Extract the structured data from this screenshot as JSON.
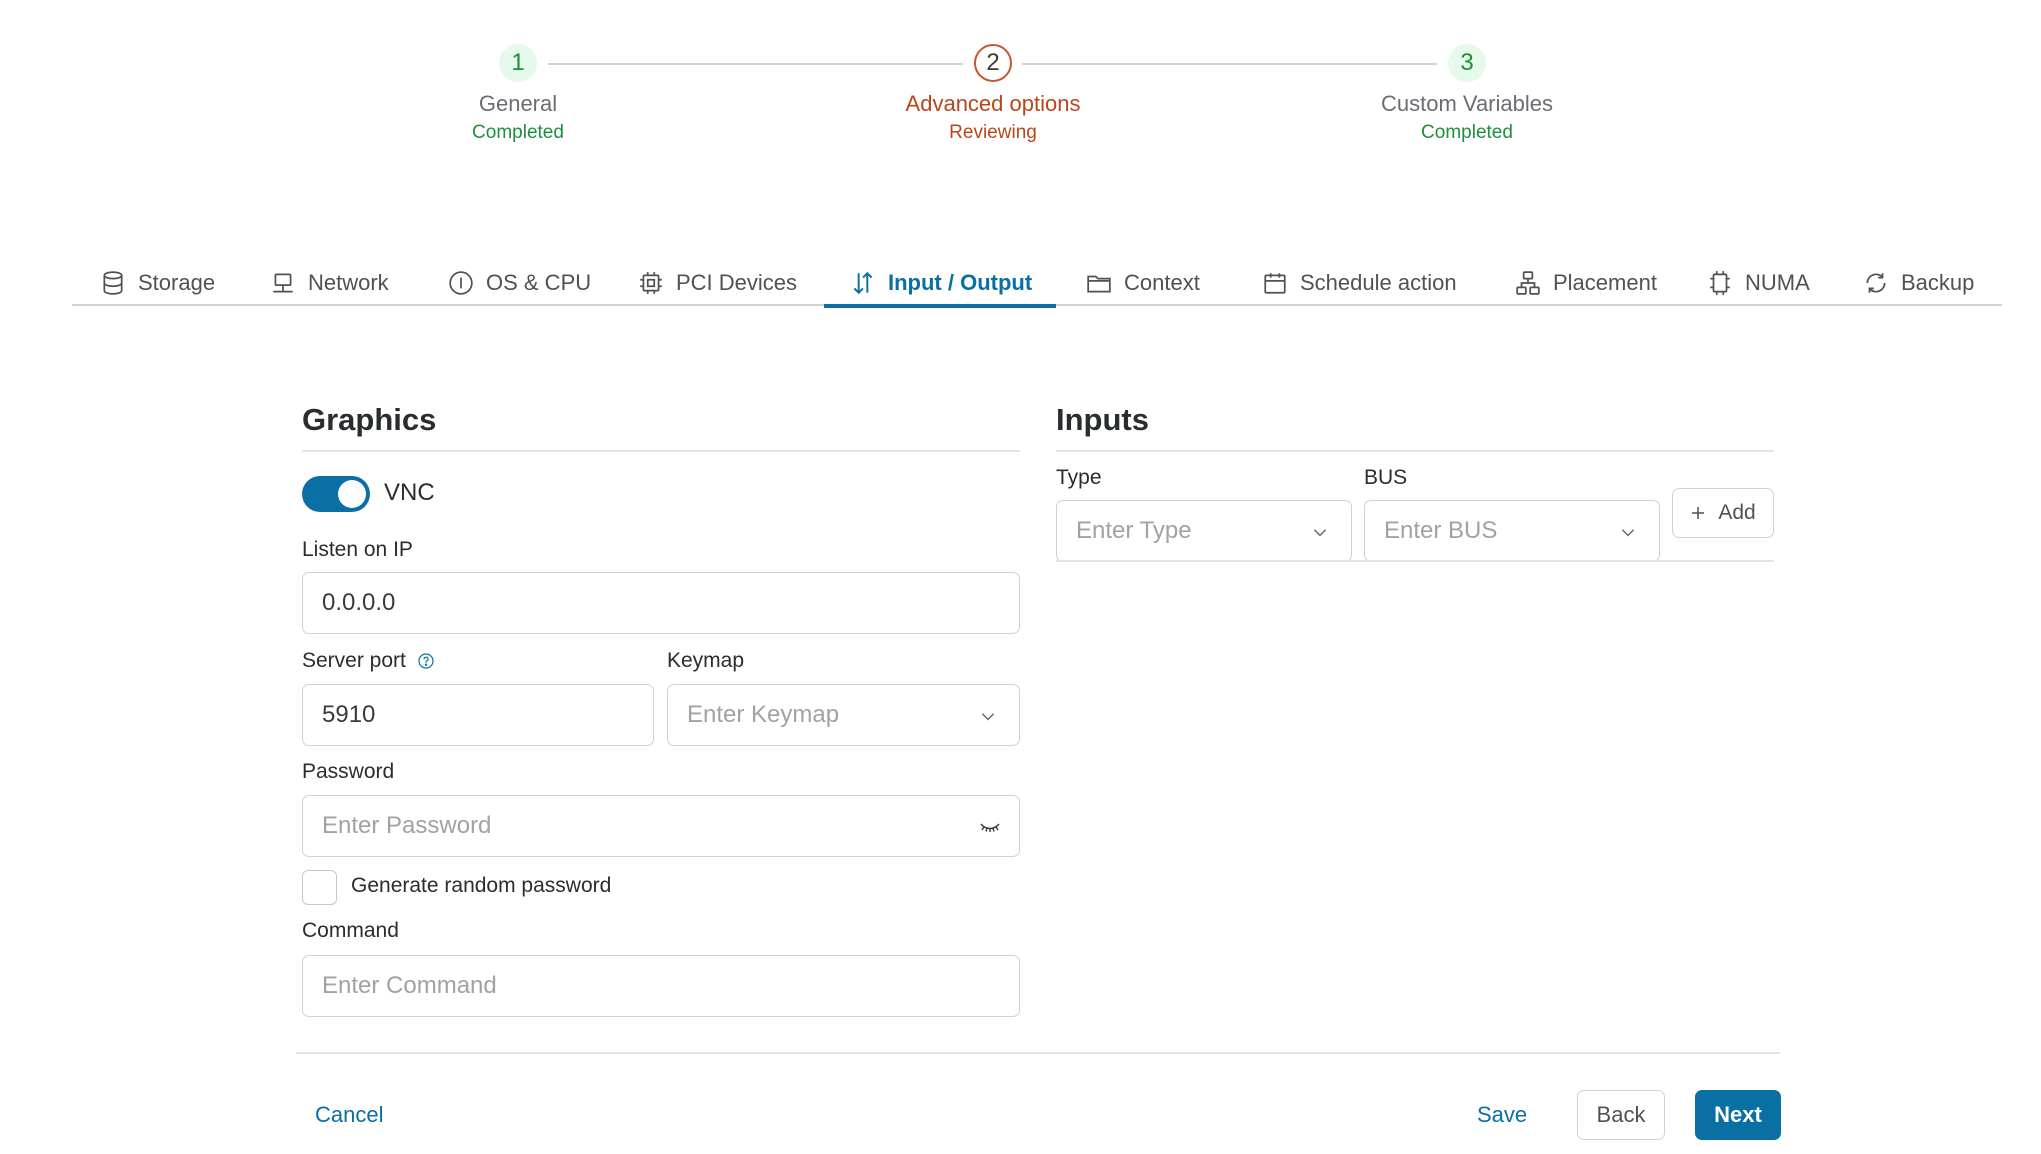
{
  "stepper": {
    "steps": [
      {
        "number": "1",
        "title": "General",
        "status": "Completed"
      },
      {
        "number": "2",
        "title": "Advanced options",
        "status": "Reviewing"
      },
      {
        "number": "3",
        "title": "Custom Variables",
        "status": "Completed"
      }
    ]
  },
  "tabs": [
    {
      "label": "Storage",
      "icon": "database-icon"
    },
    {
      "label": "Network",
      "icon": "network-icon"
    },
    {
      "label": "OS & CPU",
      "icon": "info-icon"
    },
    {
      "label": "PCI Devices",
      "icon": "chip-icon"
    },
    {
      "label": "Input / Output",
      "icon": "arrows-up-down-icon",
      "active": true
    },
    {
      "label": "Context",
      "icon": "folder-icon"
    },
    {
      "label": "Schedule action",
      "icon": "calendar-icon"
    },
    {
      "label": "Placement",
      "icon": "hierarchy-icon"
    },
    {
      "label": "NUMA",
      "icon": "cpu-icon"
    },
    {
      "label": "Backup",
      "icon": "refresh-icon"
    }
  ],
  "graphics": {
    "title": "Graphics",
    "vnc_label": "VNC",
    "vnc_enabled": true,
    "listen_ip_label": "Listen on IP",
    "listen_ip_value": "0.0.0.0",
    "server_port_label": "Server port",
    "server_port_value": "5910",
    "keymap_label": "Keymap",
    "keymap_placeholder": "Enter Keymap",
    "password_label": "Password",
    "password_placeholder": "Enter Password",
    "generate_password_label": "Generate random password",
    "command_label": "Command",
    "command_placeholder": "Enter Command"
  },
  "inputs": {
    "title": "Inputs",
    "type_label": "Type",
    "type_placeholder": "Enter Type",
    "bus_label": "BUS",
    "bus_placeholder": "Enter BUS",
    "add_label": "Add"
  },
  "footer": {
    "cancel_label": "Cancel",
    "save_label": "Save",
    "back_label": "Back",
    "next_label": "Next"
  },
  "colors": {
    "primary": "#0a6fa3",
    "success": "#1e8f3a",
    "warning": "#b8461b"
  }
}
